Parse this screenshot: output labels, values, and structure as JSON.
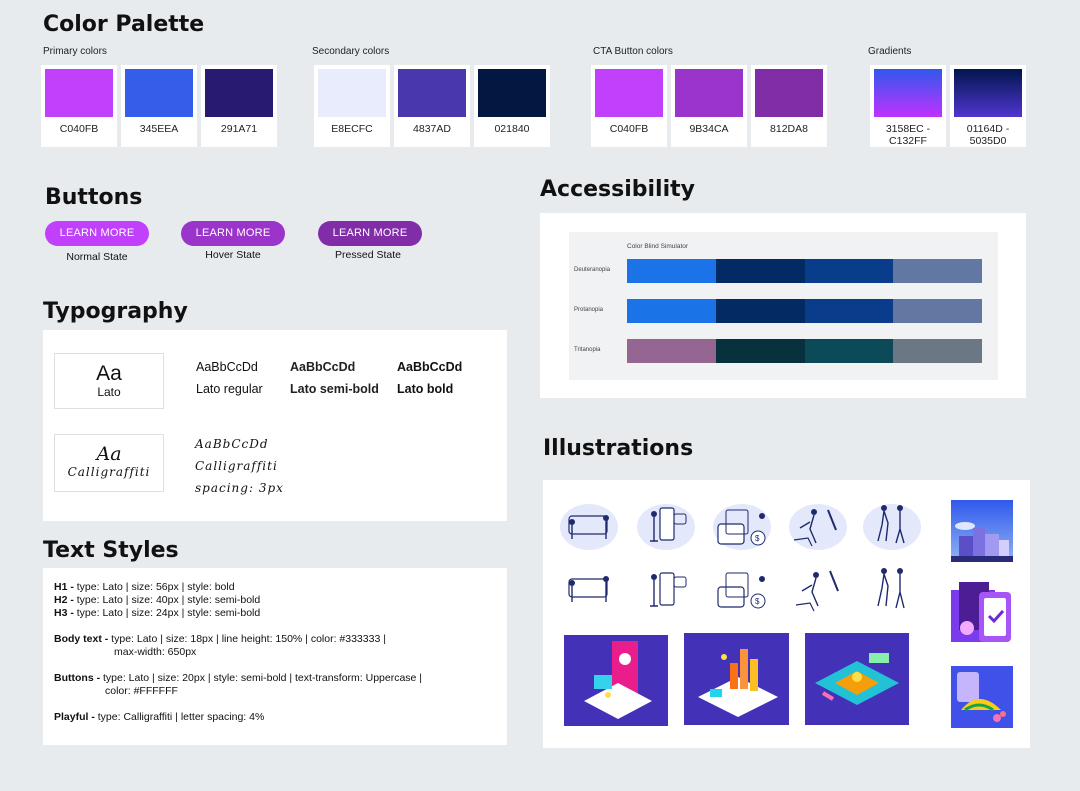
{
  "sections": {
    "color_palette": "Color Palette",
    "buttons": "Buttons",
    "typography": "Typography",
    "text_styles": "Text Styles",
    "accessibility": "Accessibility",
    "illustrations": "Illustrations"
  },
  "palette": {
    "primary": {
      "label": "Primary colors",
      "swatches": [
        {
          "code": "C040FB",
          "color": "#C040FB"
        },
        {
          "code": "345EEA",
          "color": "#345EEA"
        },
        {
          "code": "291A71",
          "color": "#291A71"
        }
      ]
    },
    "secondary": {
      "label": "Secondary colors",
      "swatches": [
        {
          "code": "E8ECFC",
          "color": "#E8ECFC"
        },
        {
          "code": "4837AD",
          "color": "#4837AD"
        },
        {
          "code": "021840",
          "color": "#021840"
        }
      ]
    },
    "cta": {
      "label": "CTA Button colors",
      "swatches": [
        {
          "code": "C040FB",
          "color": "#C040FB"
        },
        {
          "code": "9B34CA",
          "color": "#9B34CA"
        },
        {
          "code": "812DA8",
          "color": "#812DA8"
        }
      ]
    },
    "gradients": {
      "label": "Gradients",
      "swatches": [
        {
          "code1": "3158EC -",
          "code2": "C132FF",
          "from": "#3158EC",
          "to": "#C132FF"
        },
        {
          "code1": "01164D -",
          "code2": "5035D0",
          "from": "#01164D",
          "to": "#5035D0"
        }
      ]
    }
  },
  "buttons": [
    {
      "label": "LEARN MORE",
      "state": "Normal State",
      "color": "#C040FB"
    },
    {
      "label": "LEARN MORE",
      "state": "Hover State",
      "color": "#9B34CA"
    },
    {
      "label": "LEARN MORE",
      "state": "Pressed State",
      "color": "#812DA8"
    }
  ],
  "typography": {
    "lato_sample": "Aa",
    "lato_name": "Lato",
    "variants": [
      {
        "sample": "AaBbCcDd",
        "name": "Lato regular"
      },
      {
        "sample": "AaBbCcDd",
        "name": "Lato semi-bold"
      },
      {
        "sample": "AaBbCcDd",
        "name": "Lato bold"
      }
    ],
    "script_sample": "Aa",
    "script_name": "Calligraffiti",
    "script_lines": [
      "AaBbCcDd",
      "Calligraffiti",
      "spacing: 3px"
    ]
  },
  "text_styles": {
    "h1_key": "H1 -",
    "h1": " type: Lato  |  size: 56px  |  style: bold",
    "h2_key": "H2 -",
    "h2": " type: Lato  |  size: 40px  |  style: semi-bold",
    "h3_key": "H3 -",
    "h3": " type: Lato  |  size: 24px  |  style: semi-bold",
    "body_key": "Body text -",
    "body": "  type: Lato  |  size: 18px  |  line height: 150%  |  color:  #333333  |",
    "body2": "max-width: 650px",
    "buttons_key": "Buttons -",
    "buttons": "  type: Lato  |  size: 20px  |  style: semi-bold  | text-transform: Uppercase  |",
    "buttons2": "color:  #FFFFFF",
    "playful_key": "Playful -",
    "playful": " type: Calligraffiti  |  letter spacing: 4%"
  },
  "accessibility": {
    "title": "Color Blind Simulator",
    "rows": [
      {
        "label": "Deuteranopia",
        "colors": [
          "#1a74e8",
          "#042a63",
          "#0a3c8c",
          "#6377a3"
        ]
      },
      {
        "label": "Protanopia",
        "colors": [
          "#1a74e8",
          "#042a63",
          "#0a3c8c",
          "#6377a3"
        ]
      },
      {
        "label": "Tritanopia",
        "colors": [
          "#946691",
          "#07313c",
          "#0c4a5a",
          "#6b7784"
        ]
      }
    ]
  }
}
